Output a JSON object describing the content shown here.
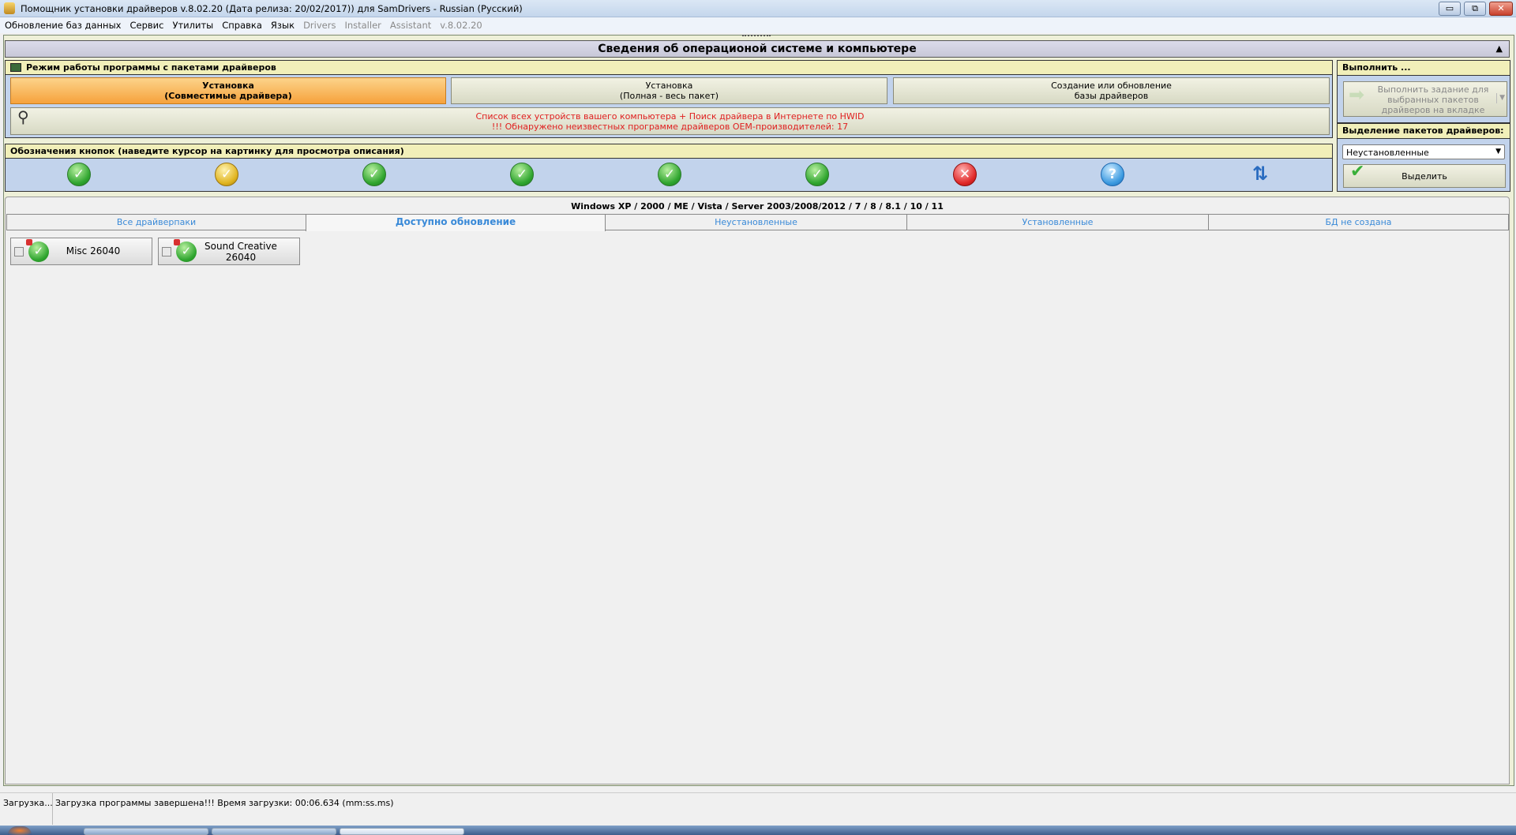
{
  "window": {
    "title": "Помощник установки драйверов v.8.02.20 (Дата релиза: 20/02/2017)) для SamDrivers - Russian (Русский)",
    "minimize": "▭",
    "restore": "⧉",
    "close": "✕"
  },
  "menu": {
    "items": [
      "Обновление баз данных",
      "Сервис",
      "Утилиты",
      "Справка",
      "Язык"
    ],
    "disabled": [
      "Drivers",
      "Installer",
      "Assistant",
      "v.8.02.20"
    ]
  },
  "header": {
    "title": "Сведения об операционой системе и компьютере",
    "collapse": "▲"
  },
  "mode": {
    "title": "Режим работы программы с пакетами драйверов",
    "buttons": [
      {
        "line1": "Установка",
        "line2": "(Совместимые драйвера)"
      },
      {
        "line1": "Установка",
        "line2": "(Полная - весь пакет)"
      },
      {
        "line1": "Создание или обновление",
        "line2": "базы драйверов"
      }
    ],
    "devices_line1": "Список всех устройств вашего компьютера + Поиск драйвера в Интернете по HWID",
    "devices_line2": "!!! Обнаружено неизвестных программе драйверов OEM-производителей: 17"
  },
  "legend": {
    "title": "Обозначения кнопок (наведите курсор на картинку для просмотра описания)",
    "icons": [
      {
        "name": "installed-ok-icon",
        "glyph": "✓",
        "cls": ""
      },
      {
        "name": "installed-warning-icon",
        "glyph": "✓",
        "cls": "y"
      },
      {
        "name": "update-available-icon",
        "glyph": "✓",
        "cls": ""
      },
      {
        "name": "newer-installed-icon",
        "glyph": "✓",
        "cls": ""
      },
      {
        "name": "update-warning-icon",
        "glyph": "✓",
        "cls": ""
      },
      {
        "name": "newer-warning-icon",
        "glyph": "✓",
        "cls": ""
      },
      {
        "name": "not-installed-icon",
        "glyph": "✕",
        "cls": "r"
      },
      {
        "name": "unknown-icon",
        "glyph": "?",
        "cls": "b"
      },
      {
        "name": "refresh-icon",
        "glyph": "⇅",
        "cls": "n"
      }
    ]
  },
  "execute": {
    "title": "Выполнить ...",
    "button_line1": "Выполнить задание для",
    "button_line2": "выбранных пакетов",
    "button_line3": "драйверов на вкладке"
  },
  "selection": {
    "title": "Выделение пакетов драйверов:",
    "dropdown_value": "Неустановленные",
    "select_button": "Выделить"
  },
  "os_line": "Windows XP / 2000 / ME / Vista / Server 2003/2008/2012 / 7 / 8 / 8.1 / 10 / 11",
  "tabs": [
    "Все драйверпаки",
    "Доступно обновление",
    "Неустановленные",
    "Установленные",
    "БД не создана"
  ],
  "packages": [
    {
      "line1": "Misc 26040",
      "line2": ""
    },
    {
      "line1": "Sound Creative",
      "line2": "26040"
    }
  ],
  "status": {
    "left": "Загрузка...",
    "message": "Загрузка программы завершена!!! Время загрузки: 00:06.634 (mm:ss.ms)"
  }
}
